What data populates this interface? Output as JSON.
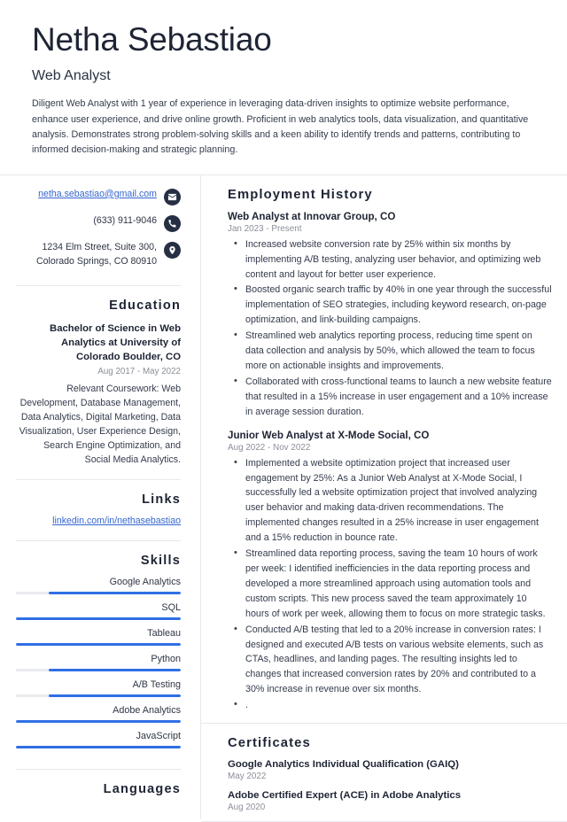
{
  "header": {
    "name": "Netha Sebastiao",
    "job_title": "Web Analyst",
    "summary": "Diligent Web Analyst with 1 year of experience in leveraging data-driven insights to optimize website performance, enhance user experience, and drive online growth. Proficient in web analytics tools, data visualization, and quantitative analysis. Demonstrates strong problem-solving skills and a keen ability to identify trends and patterns, contributing to informed decision-making and strategic planning."
  },
  "contact": {
    "email": "netha.sebastiao@gmail.com",
    "phone": "(633) 911-9046",
    "address": "1234 Elm Street, Suite 300, Colorado Springs, CO 80910",
    "icons": {
      "email": "envelope-icon",
      "phone": "phone-icon",
      "address": "map-pin-icon"
    }
  },
  "education": {
    "heading": "Education",
    "degree": "Bachelor of Science in Web Analytics at University of Colorado Boulder, CO",
    "date": "Aug 2017 - May 2022",
    "description": "Relevant Coursework: Web Development, Database Management, Data Analytics, Digital Marketing, Data Visualization, User Experience Design, Search Engine Optimization, and Social Media Analytics."
  },
  "links": {
    "heading": "Links",
    "items": [
      {
        "label": "linkedin.com/in/nethasebastiao"
      }
    ]
  },
  "skills": {
    "heading": "Skills",
    "items": [
      {
        "label": "Google Analytics",
        "level": 80
      },
      {
        "label": "SQL",
        "level": 100
      },
      {
        "label": "Tableau",
        "level": 100
      },
      {
        "label": "Python",
        "level": 80
      },
      {
        "label": "A/B Testing",
        "level": 80
      },
      {
        "label": "Adobe Analytics",
        "level": 100
      },
      {
        "label": "JavaScript",
        "level": 100
      }
    ]
  },
  "languages": {
    "heading": "Languages"
  },
  "employment": {
    "heading": "Employment History",
    "jobs": [
      {
        "title": "Web Analyst at Innovar Group, CO",
        "date": "Jan 2023 - Present",
        "bullets": [
          "Increased website conversion rate by 25% within six months by implementing A/B testing, analyzing user behavior, and optimizing web content and layout for better user experience.",
          "Boosted organic search traffic by 40% in one year through the successful implementation of SEO strategies, including keyword research, on-page optimization, and link-building campaigns.",
          "Streamlined web analytics reporting process, reducing time spent on data collection and analysis by 50%, which allowed the team to focus more on actionable insights and improvements.",
          "Collaborated with cross-functional teams to launch a new website feature that resulted in a 15% increase in user engagement and a 10% increase in average session duration."
        ]
      },
      {
        "title": "Junior Web Analyst at X-Mode Social, CO",
        "date": "Aug 2022 - Nov 2022",
        "bullets": [
          "Implemented a website optimization project that increased user engagement by 25%: As a Junior Web Analyst at X-Mode Social, I successfully led a website optimization project that involved analyzing user behavior and making data-driven recommendations. The implemented changes resulted in a 25% increase in user engagement and a 15% reduction in bounce rate.",
          "Streamlined data reporting process, saving the team 10 hours of work per week: I identified inefficiencies in the data reporting process and developed a more streamlined approach using automation tools and custom scripts. This new process saved the team approximately 10 hours of work per week, allowing them to focus on more strategic tasks.",
          "Conducted A/B testing that led to a 20% increase in conversion rates: I designed and executed A/B tests on various website elements, such as CTAs, headlines, and landing pages. The resulting insights led to changes that increased conversion rates by 20% and contributed to a 30% increase in revenue over six months.",
          "."
        ]
      }
    ]
  },
  "certificates": {
    "heading": "Certificates",
    "items": [
      {
        "name": "Google Analytics Individual Qualification (GAIQ)",
        "date": "May 2022"
      },
      {
        "name": "Adobe Certified Expert (ACE) in Adobe Analytics",
        "date": "Aug 2020"
      }
    ]
  },
  "colors": {
    "accent_blue": "#2f6fe4",
    "link_blue": "#3566cf",
    "icon_navy": "#262f44",
    "text_dark": "#1e2434",
    "text_muted": "#8b8f99",
    "rule": "#e6e8ec"
  }
}
